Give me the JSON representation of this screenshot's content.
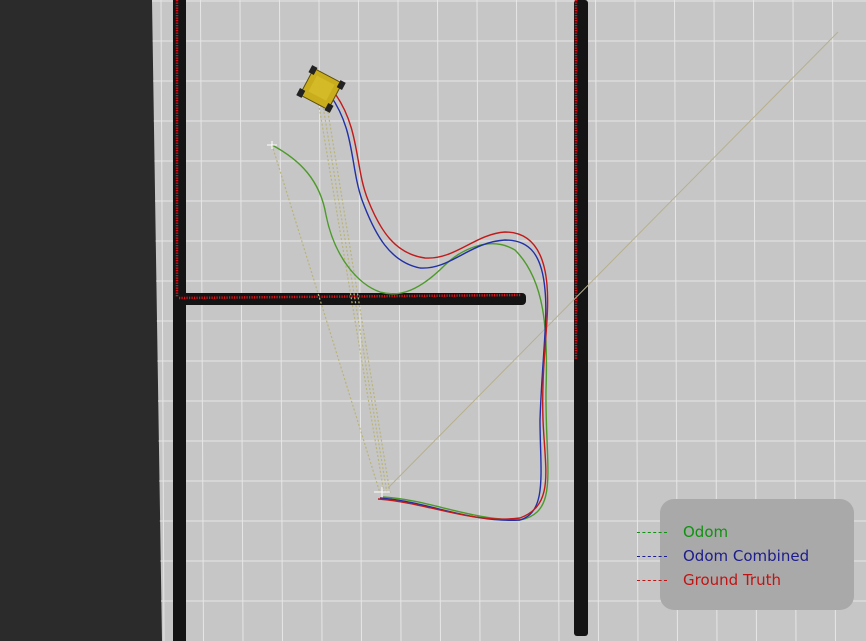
{
  "scene": {
    "background_color": "#2b2b2b",
    "floor_color": "#c6c6c6",
    "grid_color": "#e6e6e6",
    "wall_color": "#141414",
    "laser_color": "#e0101a",
    "robot_color": "#c9ad1d",
    "diagonal_line_color": "#b7b08e"
  },
  "legend": {
    "items": [
      {
        "label": "Odom",
        "color": "#119111"
      },
      {
        "label": "Odom Combined",
        "color": "#1c1c8c"
      },
      {
        "label": "Ground Truth",
        "color": "#c01414"
      }
    ]
  },
  "trajectories": [
    {
      "name": "odom",
      "color": "#4d9a2a"
    },
    {
      "name": "odom-combined",
      "color": "#2130a6"
    },
    {
      "name": "ground-truth",
      "color": "#c21a1a"
    }
  ]
}
